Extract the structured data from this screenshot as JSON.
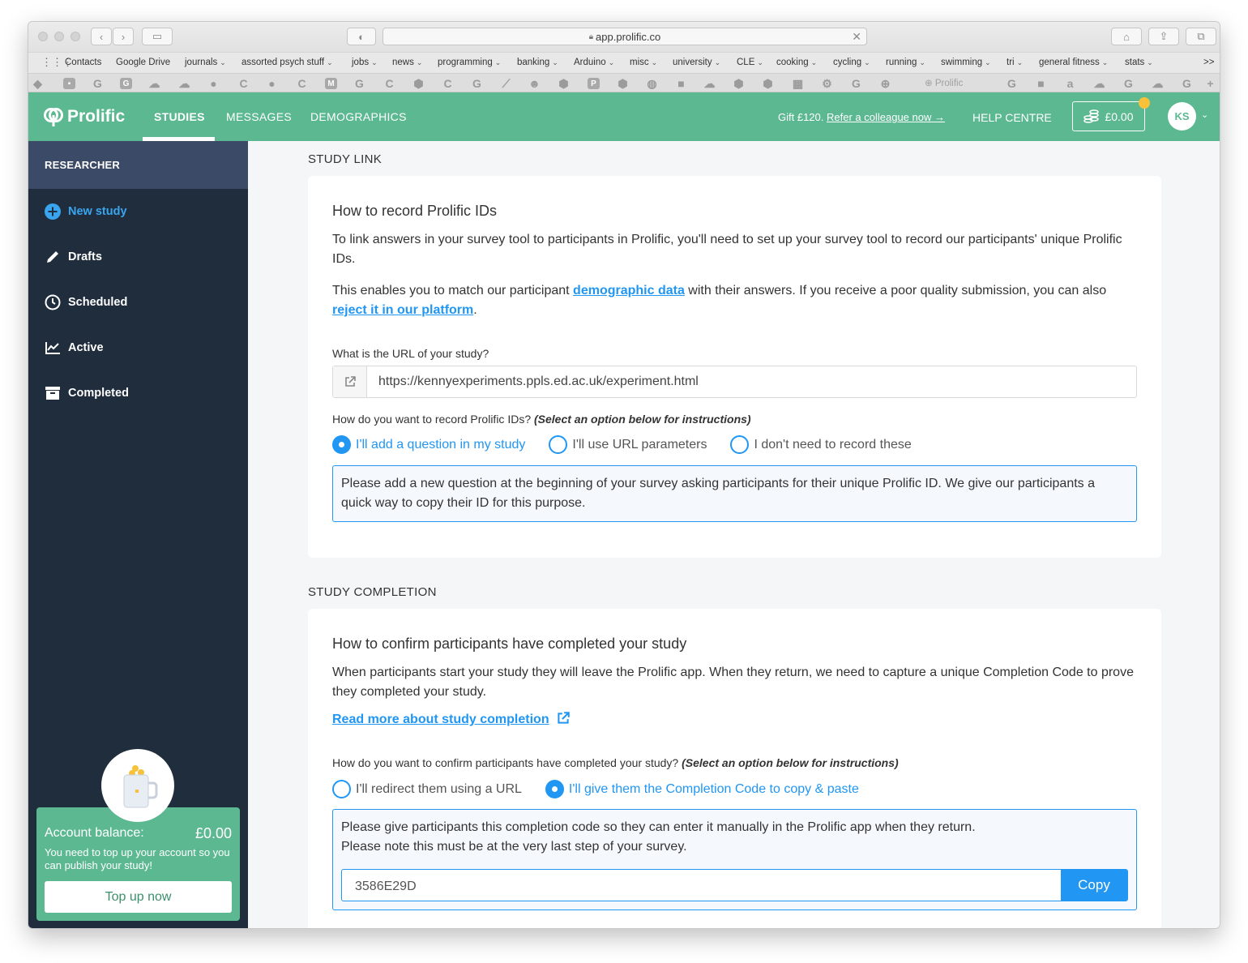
{
  "browser": {
    "url": "app.prolific.co",
    "bookmarks": [
      "Contacts",
      "Google Drive",
      "journals",
      "assorted psych stuff",
      "jobs",
      "news",
      "programming",
      "banking",
      "Arduino",
      "misc",
      "university",
      "CLE",
      "cooking",
      "cycling",
      "running",
      "swimming",
      "tri",
      "general fitness",
      "stats"
    ],
    "overflow": ">>",
    "favorite_tab_label": "Prolific"
  },
  "header": {
    "logo": "Prolific",
    "nav": [
      "STUDIES",
      "MESSAGES",
      "DEMOGRAPHICS"
    ],
    "gift_text": "Gift £120.",
    "gift_link": "Refer a colleague now →",
    "help": "HELP CENTRE",
    "balance": "£0.00",
    "avatar": "KS"
  },
  "sidebar": {
    "heading": "RESEARCHER",
    "items": [
      {
        "label": "New study",
        "icon": "plus-circle-icon"
      },
      {
        "label": "Drafts",
        "icon": "pencil-icon"
      },
      {
        "label": "Scheduled",
        "icon": "clock-icon"
      },
      {
        "label": "Active",
        "icon": "chart-line-icon"
      },
      {
        "label": "Completed",
        "icon": "archive-icon"
      }
    ],
    "account": {
      "label": "Account balance:",
      "amount": "£0.00",
      "message": "You need to top up your account so you can publish your study!",
      "button": "Top up now"
    }
  },
  "study_link": {
    "section_title": "STUDY LINK",
    "heading": "How to record Prolific IDs",
    "para1": "To link answers in your survey tool to participants in Prolific, you'll need to set up your survey tool to record our participants' unique Prolific IDs.",
    "para2_pre": "This enables you to match our participant ",
    "para2_link1": "demographic data",
    "para2_mid": " with their answers. If you receive a poor quality submission, you can also ",
    "para2_link2": "reject it in our platform",
    "para2_post": ".",
    "url_label": "What is the URL of your study?",
    "url_value": "https://kennyexperiments.ppls.ed.ac.uk/experiment.html",
    "record_label": "How do you want to record Prolific IDs?",
    "record_hint": "(Select an option below for instructions)",
    "options": [
      "I'll add a question in my study",
      "I'll use URL parameters",
      "I don't need to record these"
    ],
    "selected_option": "I'll add a question in my study",
    "instructions": "Please add a new question at the beginning of your survey asking participants for their unique Prolific ID. We give our participants a quick way to copy their ID for this purpose."
  },
  "study_completion": {
    "section_title": "STUDY COMPLETION",
    "heading": "How to confirm participants have completed your study",
    "para1": "When participants start your study they will leave the Prolific app. When they return, we need to capture a unique Completion Code to prove they completed your study.",
    "read_more": "Read more about study completion",
    "confirm_label": "How do you want to confirm participants have completed your study?",
    "confirm_hint": "(Select an option below for instructions)",
    "options": [
      "I'll redirect them using a URL",
      "I'll give them the Completion Code to copy & paste"
    ],
    "selected_option": "I'll give them the Completion Code to copy & paste",
    "instructions_line1": "Please give participants this completion code so they can enter it manually in the Prolific app when they return.",
    "instructions_line2": "Please note this must be at the very last step of your survey.",
    "code": "3586E29D",
    "copy_button": "Copy"
  },
  "colors": {
    "brand_green": "#5bb891",
    "sidebar_dark": "#1f2d3d",
    "accent_blue": "#2196f3"
  }
}
